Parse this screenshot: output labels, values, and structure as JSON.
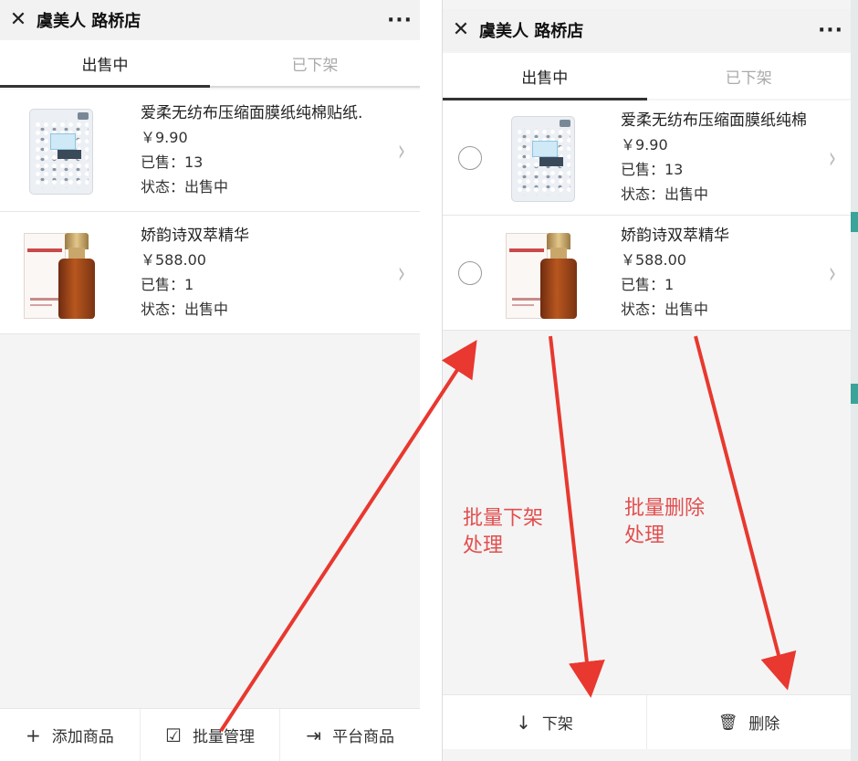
{
  "header": {
    "close_glyph": "✕",
    "title": "虞美人 路桥店",
    "more_glyph": "···"
  },
  "tabs": [
    {
      "label": "出售中",
      "active": true
    },
    {
      "label": "已下架",
      "active": false
    }
  ],
  "products": [
    {
      "name_left": "爱柔无纺布压缩面膜纸纯棉贴纸.",
      "name_right": "爱柔无纺布压缩面膜纸纯棉",
      "price": "￥9.90",
      "sold": "已售：13",
      "status": "状态：出售中",
      "icon": "tissue-pack-image"
    },
    {
      "name_left": "娇韵诗双萃精华",
      "name_right": "娇韵诗双萃精华",
      "price": "￥588.00",
      "sold": "已售：1",
      "status": "状态：出售中",
      "icon": "serum-bottle-image"
    }
  ],
  "left_bottom_bar": [
    {
      "icon": "plus-icon",
      "glyph": "+",
      "label": "添加商品"
    },
    {
      "icon": "checkbox-icon",
      "glyph": "☑",
      "label": "批量管理"
    },
    {
      "icon": "enter-icon",
      "glyph": "⇥",
      "label": "平台商品"
    }
  ],
  "right_bottom_bar": [
    {
      "icon": "arrow-down-icon",
      "glyph": "↓",
      "label": "下架"
    },
    {
      "icon": "trash-icon",
      "glyph": "🗑",
      "label": "删除"
    }
  ],
  "annotations": {
    "batch_off_line1": "批量下架",
    "batch_off_line2": "处理",
    "batch_delete_line1": "批量删除",
    "batch_delete_line2": "处理"
  },
  "chevron_glyph": "›",
  "colors": {
    "annotation_red": "#e24e4e",
    "tab_active": "#222222",
    "tab_inactive": "#aaaaaa",
    "edge_teal": "#3aa39a"
  }
}
